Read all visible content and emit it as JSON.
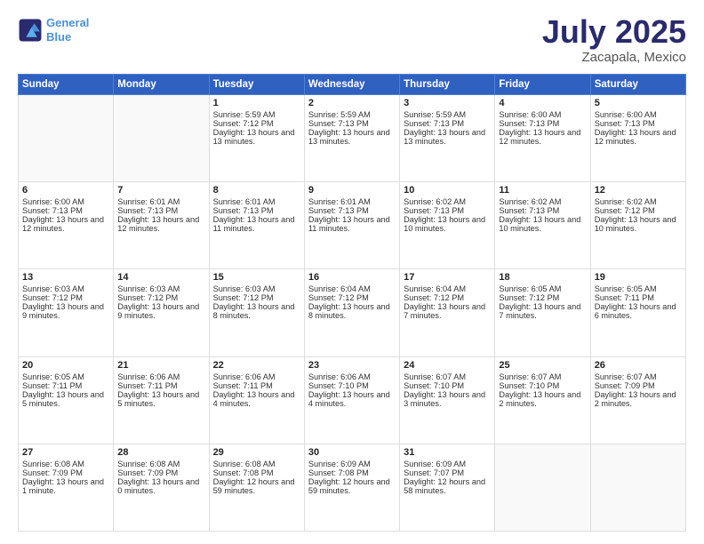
{
  "header": {
    "logo_line1": "General",
    "logo_line2": "Blue",
    "title": "July 2025",
    "subtitle": "Zacapala, Mexico"
  },
  "weekdays": [
    "Sunday",
    "Monday",
    "Tuesday",
    "Wednesday",
    "Thursday",
    "Friday",
    "Saturday"
  ],
  "weeks": [
    [
      {
        "day": "",
        "info": ""
      },
      {
        "day": "",
        "info": ""
      },
      {
        "day": "1",
        "info": "Sunrise: 5:59 AM\nSunset: 7:12 PM\nDaylight: 13 hours and 13 minutes."
      },
      {
        "day": "2",
        "info": "Sunrise: 5:59 AM\nSunset: 7:13 PM\nDaylight: 13 hours and 13 minutes."
      },
      {
        "day": "3",
        "info": "Sunrise: 5:59 AM\nSunset: 7:13 PM\nDaylight: 13 hours and 13 minutes."
      },
      {
        "day": "4",
        "info": "Sunrise: 6:00 AM\nSunset: 7:13 PM\nDaylight: 13 hours and 12 minutes."
      },
      {
        "day": "5",
        "info": "Sunrise: 6:00 AM\nSunset: 7:13 PM\nDaylight: 13 hours and 12 minutes."
      }
    ],
    [
      {
        "day": "6",
        "info": "Sunrise: 6:00 AM\nSunset: 7:13 PM\nDaylight: 13 hours and 12 minutes."
      },
      {
        "day": "7",
        "info": "Sunrise: 6:01 AM\nSunset: 7:13 PM\nDaylight: 13 hours and 12 minutes."
      },
      {
        "day": "8",
        "info": "Sunrise: 6:01 AM\nSunset: 7:13 PM\nDaylight: 13 hours and 11 minutes."
      },
      {
        "day": "9",
        "info": "Sunrise: 6:01 AM\nSunset: 7:13 PM\nDaylight: 13 hours and 11 minutes."
      },
      {
        "day": "10",
        "info": "Sunrise: 6:02 AM\nSunset: 7:13 PM\nDaylight: 13 hours and 10 minutes."
      },
      {
        "day": "11",
        "info": "Sunrise: 6:02 AM\nSunset: 7:13 PM\nDaylight: 13 hours and 10 minutes."
      },
      {
        "day": "12",
        "info": "Sunrise: 6:02 AM\nSunset: 7:12 PM\nDaylight: 13 hours and 10 minutes."
      }
    ],
    [
      {
        "day": "13",
        "info": "Sunrise: 6:03 AM\nSunset: 7:12 PM\nDaylight: 13 hours and 9 minutes."
      },
      {
        "day": "14",
        "info": "Sunrise: 6:03 AM\nSunset: 7:12 PM\nDaylight: 13 hours and 9 minutes."
      },
      {
        "day": "15",
        "info": "Sunrise: 6:03 AM\nSunset: 7:12 PM\nDaylight: 13 hours and 8 minutes."
      },
      {
        "day": "16",
        "info": "Sunrise: 6:04 AM\nSunset: 7:12 PM\nDaylight: 13 hours and 8 minutes."
      },
      {
        "day": "17",
        "info": "Sunrise: 6:04 AM\nSunset: 7:12 PM\nDaylight: 13 hours and 7 minutes."
      },
      {
        "day": "18",
        "info": "Sunrise: 6:05 AM\nSunset: 7:12 PM\nDaylight: 13 hours and 7 minutes."
      },
      {
        "day": "19",
        "info": "Sunrise: 6:05 AM\nSunset: 7:11 PM\nDaylight: 13 hours and 6 minutes."
      }
    ],
    [
      {
        "day": "20",
        "info": "Sunrise: 6:05 AM\nSunset: 7:11 PM\nDaylight: 13 hours and 5 minutes."
      },
      {
        "day": "21",
        "info": "Sunrise: 6:06 AM\nSunset: 7:11 PM\nDaylight: 13 hours and 5 minutes."
      },
      {
        "day": "22",
        "info": "Sunrise: 6:06 AM\nSunset: 7:11 PM\nDaylight: 13 hours and 4 minutes."
      },
      {
        "day": "23",
        "info": "Sunrise: 6:06 AM\nSunset: 7:10 PM\nDaylight: 13 hours and 4 minutes."
      },
      {
        "day": "24",
        "info": "Sunrise: 6:07 AM\nSunset: 7:10 PM\nDaylight: 13 hours and 3 minutes."
      },
      {
        "day": "25",
        "info": "Sunrise: 6:07 AM\nSunset: 7:10 PM\nDaylight: 13 hours and 2 minutes."
      },
      {
        "day": "26",
        "info": "Sunrise: 6:07 AM\nSunset: 7:09 PM\nDaylight: 13 hours and 2 minutes."
      }
    ],
    [
      {
        "day": "27",
        "info": "Sunrise: 6:08 AM\nSunset: 7:09 PM\nDaylight: 13 hours and 1 minute."
      },
      {
        "day": "28",
        "info": "Sunrise: 6:08 AM\nSunset: 7:09 PM\nDaylight: 13 hours and 0 minutes."
      },
      {
        "day": "29",
        "info": "Sunrise: 6:08 AM\nSunset: 7:08 PM\nDaylight: 12 hours and 59 minutes."
      },
      {
        "day": "30",
        "info": "Sunrise: 6:09 AM\nSunset: 7:08 PM\nDaylight: 12 hours and 59 minutes."
      },
      {
        "day": "31",
        "info": "Sunrise: 6:09 AM\nSunset: 7:07 PM\nDaylight: 12 hours and 58 minutes."
      },
      {
        "day": "",
        "info": ""
      },
      {
        "day": "",
        "info": ""
      }
    ]
  ]
}
